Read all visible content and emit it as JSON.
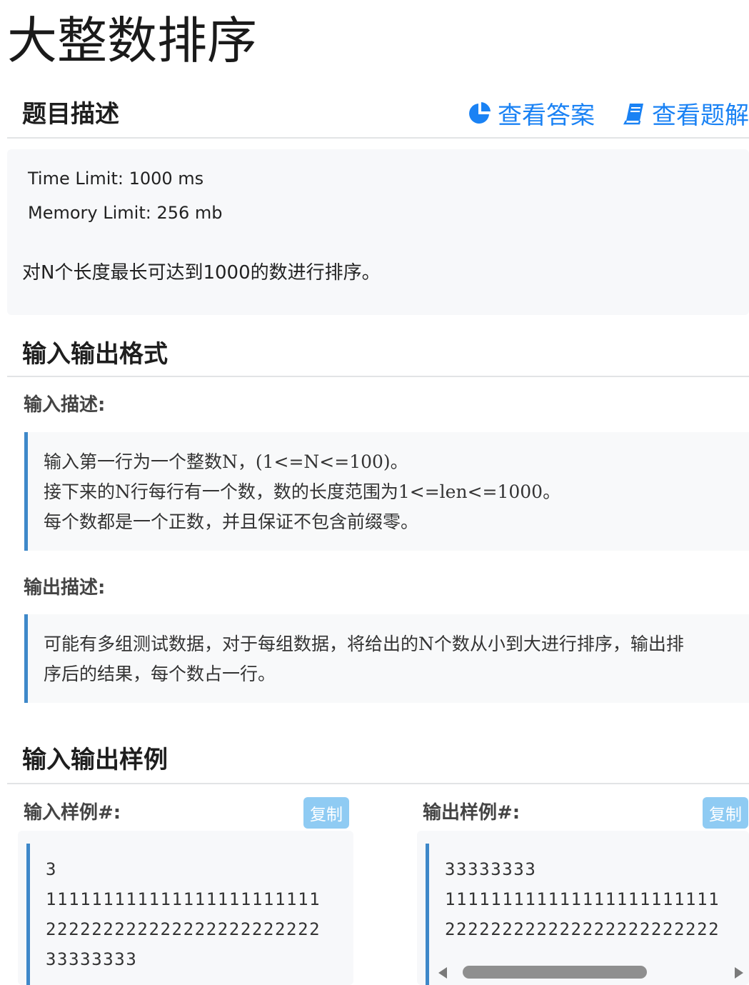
{
  "page_title": "大整数排序",
  "problem": {
    "heading": "题目描述",
    "actions": [
      {
        "label": "查看答案",
        "icon": "pie-chart-icon"
      },
      {
        "label": "查看题解",
        "icon": "book-icon"
      }
    ],
    "time_limit": "Time Limit: 1000 ms",
    "memory_limit": "Memory Limit: 256 mb",
    "description": "对N个长度最长可达到1000的数进行排序。"
  },
  "io_format": {
    "heading": "输入输出格式",
    "input_label": "输入描述:",
    "input_lines": [
      "输入第一行为一个整数N，(1<=N<=100)。",
      "接下来的N行每行有一个数，数的长度范围为1<=len<=1000。",
      "每个数都是一个正数，并且保证不包含前缀零。"
    ],
    "output_label": "输出描述:",
    "output_lines": [
      "可能有多组测试数据，对于每组数据，将给出的N个数从小到大进行排序，输出排",
      "序后的结果，每个数占一行。"
    ]
  },
  "samples": {
    "heading": "输入输出样例",
    "input_label": "输入样例#:",
    "output_label": "输出样例#:",
    "copy_label": "复制",
    "input_lines": [
      "3",
      "111111111111111111111111",
      "222222222222222222222222",
      "33333333"
    ],
    "output_lines": [
      "33333333",
      "111111111111111111111111",
      "222222222222222222222222"
    ]
  },
  "colors": {
    "link": "#1a82f4",
    "quote_border": "#3e88c9",
    "copy_button": "#8fcbf3"
  }
}
